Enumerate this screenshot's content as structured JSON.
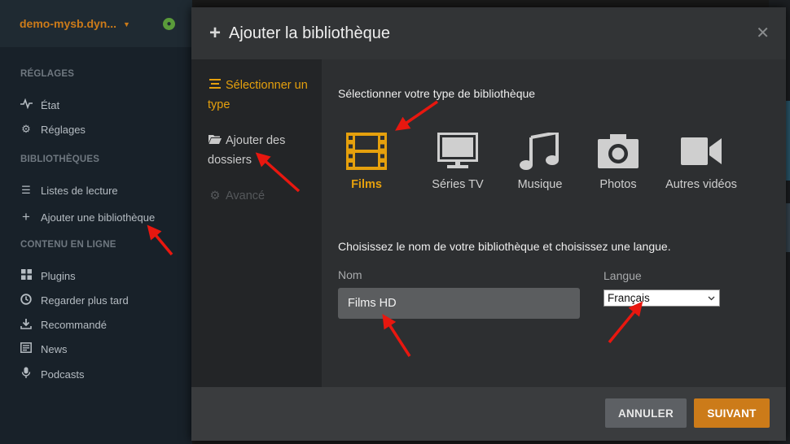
{
  "app": {
    "server_name": "demo-mysb.dyn...",
    "sidebar": {
      "section_settings": "RÉGLAGES",
      "item_status": "État",
      "item_settings": "Réglages",
      "section_libraries": "BIBLIOTHÈQUES",
      "item_playlists": "Listes de lecture",
      "item_add_library": "Ajouter une bibliothèque",
      "section_online": "CONTENU EN LIGNE",
      "item_plugins": "Plugins",
      "item_watch_later": "Regarder plus tard",
      "item_recommended": "Recommandé",
      "item_news": "News",
      "item_podcasts": "Podcasts"
    }
  },
  "modal": {
    "title": "Ajouter la bibliothèque",
    "steps": {
      "select_type": "Sélectionner un type",
      "add_folders": "Ajouter des dossiers",
      "advanced": "Avancé"
    },
    "type_prompt": "Sélectionner votre type de bibliothèque",
    "types": {
      "films": "Films",
      "tv": "Séries TV",
      "music": "Musique",
      "photos": "Photos",
      "other_videos": "Autres vidéos"
    },
    "name_prompt": "Choisissez le nom de votre bibliothèque et choisissez une langue.",
    "name_label": "Nom",
    "name_value": "Films HD",
    "language_label": "Langue",
    "language_value": "Français",
    "cancel_label": "ANNULER",
    "next_label": "SUIVANT"
  },
  "colors": {
    "accent": "#e5a00d",
    "button_next": "#cc7b19",
    "annotation_arrow": "#e8170f"
  }
}
